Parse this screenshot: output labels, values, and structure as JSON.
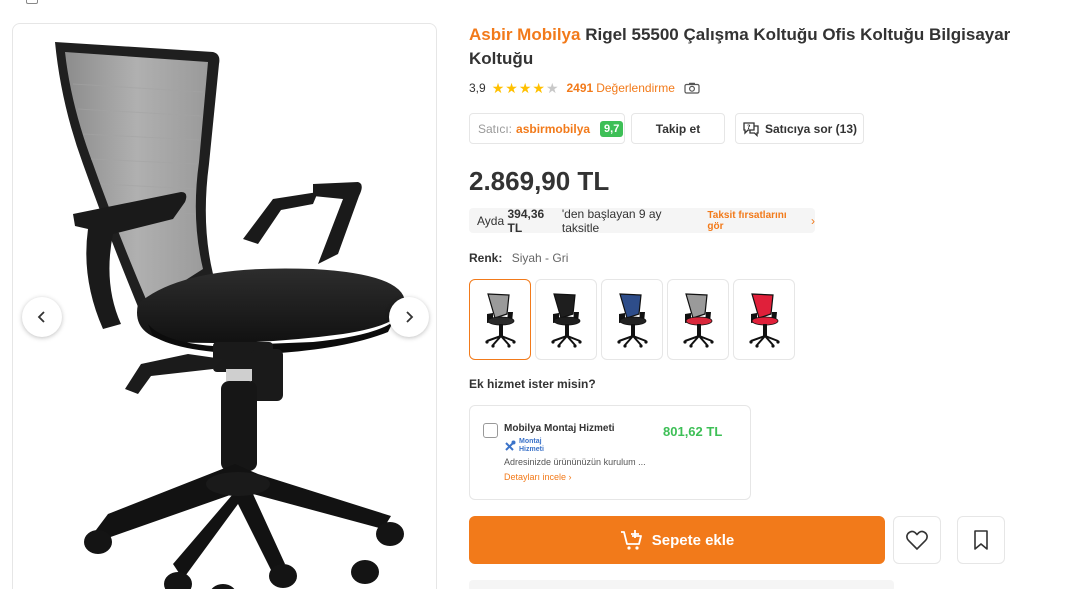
{
  "product": {
    "brand": "Asbir Mobilya",
    "name": "Rigel 55500 Çalışma Koltuğu Ofis Koltuğu Bilgisayar Koltuğu",
    "rating": "3,9",
    "stars_filled": 4,
    "stars_total": 5,
    "review_count": "2491",
    "review_label": "Değerlendirme"
  },
  "seller": {
    "label": "Satıcı:",
    "name": "asbirmobilya",
    "score": "9,7",
    "follow_label": "Takip et",
    "ask_label": "Satıcıya sor (13)"
  },
  "price": "2.869,90 TL",
  "installment": {
    "prefix": "Ayda",
    "amount": "394,36 TL",
    "suffix": "'den başlayan 9 ay taksitle",
    "link": "Taksit fırsatlarını gör"
  },
  "color": {
    "label": "Renk:",
    "value": "Siyah - Gri",
    "options": [
      {
        "name": "Siyah - Gri",
        "back": "#9a9a9a",
        "seat": "#2a2a2a"
      },
      {
        "name": "Siyah",
        "back": "#1e1e1e",
        "seat": "#1e1e1e"
      },
      {
        "name": "Lacivert",
        "back": "#2e4d8a",
        "seat": "#222222"
      },
      {
        "name": "Gri - Kırmızı",
        "back": "#9a9a9a",
        "seat": "#d9283c"
      },
      {
        "name": "Kırmızı",
        "back": "#e0203a",
        "seat": "#e0203a"
      }
    ]
  },
  "extra_service": {
    "title": "Ek hizmet ister misin?",
    "name": "Mobilya Montaj Hizmeti",
    "logo_text_1": "Montaj",
    "logo_text_2": "Hizmeti",
    "price": "801,62 TL",
    "description": "Adresinizde ürününüzün kurulum ...",
    "link": "Detayları incele"
  },
  "actions": {
    "add_to_cart": "Sepete ekle"
  },
  "colors": {
    "accent": "#f27a1a",
    "success": "#3dbf56",
    "star": "#ffc000"
  },
  "icons": {
    "prev": "chevron-left-icon",
    "next": "chevron-right-icon",
    "camera": "camera-icon",
    "chat": "chat-question-icon",
    "cart": "cart-plus-icon",
    "heart": "heart-icon",
    "bookmark": "bookmark-icon"
  }
}
